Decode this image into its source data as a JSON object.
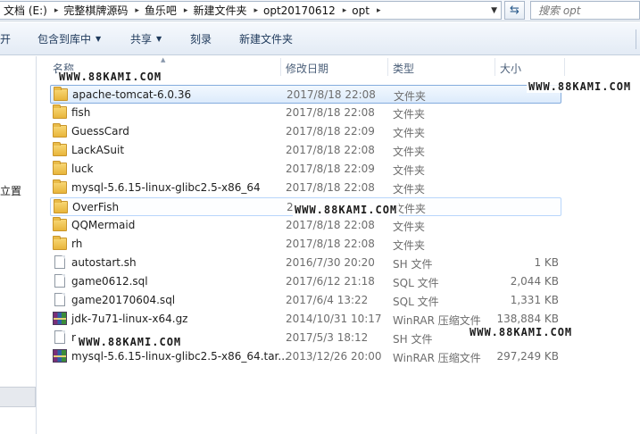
{
  "address_bar": {
    "crumbs": [
      "文档 (E:)",
      "完整棋牌源码",
      "鱼乐吧",
      "新建文件夹",
      "opt20170612",
      "opt"
    ],
    "separator": "▸",
    "dropdown_icon": "chevron-down-icon",
    "refresh_icon": "refresh-icon"
  },
  "search": {
    "placeholder": "搜索 opt",
    "icon": "search-icon"
  },
  "toolbar": {
    "open_label": "开",
    "include_library_label": "包含到库中",
    "share_label": "共享",
    "burn_label": "刻录",
    "new_folder_label": "新建文件夹"
  },
  "nav": {
    "location_label": "立置"
  },
  "columns": {
    "name": "名称",
    "modified": "修改日期",
    "type": "类型",
    "size": "大小"
  },
  "files": [
    {
      "name": "apache-tomcat-6.0.36",
      "date": "2017/8/18 22:08",
      "type": "文件夹",
      "size": "",
      "kind": "folder",
      "selected": true
    },
    {
      "name": "fish",
      "date": "2017/8/18 22:08",
      "type": "文件夹",
      "size": "",
      "kind": "folder"
    },
    {
      "name": "GuessCard",
      "date": "2017/8/18 22:09",
      "type": "文件夹",
      "size": "",
      "kind": "folder"
    },
    {
      "name": "LackASuit",
      "date": "2017/8/18 22:08",
      "type": "文件夹",
      "size": "",
      "kind": "folder"
    },
    {
      "name": "luck",
      "date": "2017/8/18 22:09",
      "type": "文件夹",
      "size": "",
      "kind": "folder"
    },
    {
      "name": "mysql-5.6.15-linux-glibc2.5-x86_64",
      "date": "2017/8/18 22:08",
      "type": "文件夹",
      "size": "",
      "kind": "folder"
    },
    {
      "name": "OverFish",
      "date": "2",
      "type": "文件夹",
      "size": "",
      "kind": "folder",
      "hover": true
    },
    {
      "name": "QQMermaid",
      "date": "2017/8/18 22:08",
      "type": "文件夹",
      "size": "",
      "kind": "folder"
    },
    {
      "name": "rh",
      "date": "2017/8/18 22:08",
      "type": "文件夹",
      "size": "",
      "kind": "folder"
    },
    {
      "name": "autostart.sh",
      "date": "2016/7/30 20:20",
      "type": "SH 文件",
      "size": "1 KB",
      "kind": "doc"
    },
    {
      "name": "game0612.sql",
      "date": "2017/6/12 21:18",
      "type": "SQL 文件",
      "size": "2,044 KB",
      "kind": "doc"
    },
    {
      "name": "game20170604.sql",
      "date": "2017/6/4 13:22",
      "type": "SQL 文件",
      "size": "1,331 KB",
      "kind": "doc"
    },
    {
      "name": "jdk-7u71-linux-x64.gz",
      "date": "2014/10/31 10:17",
      "type": "WinRAR 压缩文件",
      "size": "138,884 KB",
      "kind": "rar"
    },
    {
      "name": "r",
      "date": "2017/5/3 18:12",
      "type": "SH 文件",
      "size": "",
      "kind": "doc"
    },
    {
      "name": "mysql-5.6.15-linux-glibc2.5-x86_64.tar...",
      "date": "2013/12/26 20:00",
      "type": "WinRAR 压缩文件",
      "size": "297,249 KB",
      "kind": "rar"
    }
  ],
  "watermark": "WWW.88KAMI.COM"
}
